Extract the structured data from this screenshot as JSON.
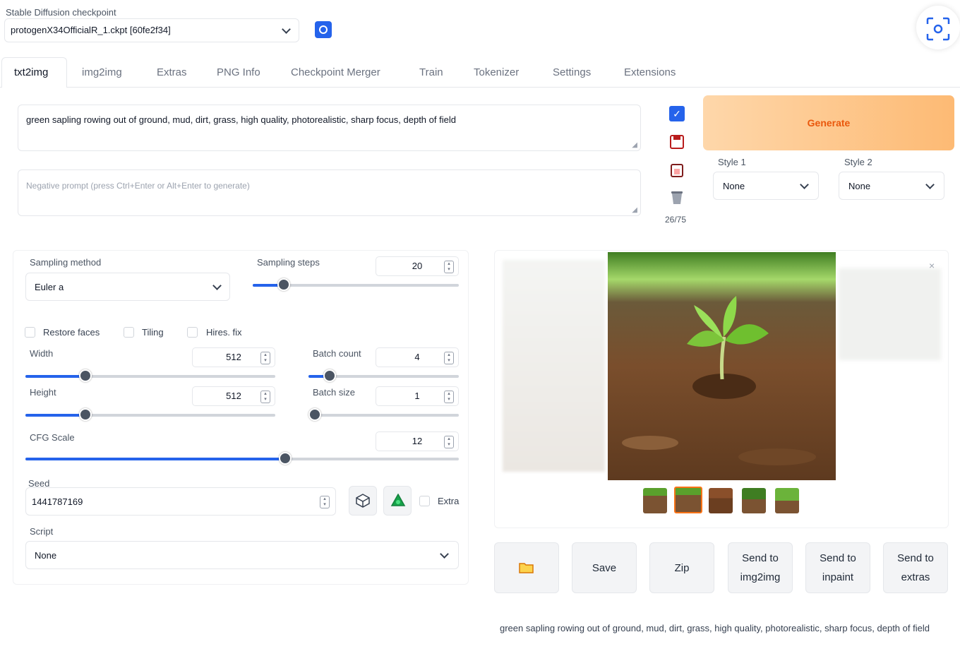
{
  "checkpoint": {
    "label": "Stable Diffusion checkpoint",
    "value": "protogenX34OfficialR_1.ckpt [60fe2f34]"
  },
  "tabs": [
    "txt2img",
    "img2img",
    "Extras",
    "PNG Info",
    "Checkpoint Merger",
    "Train",
    "Tokenizer",
    "Settings",
    "Extensions"
  ],
  "active_tab": "txt2img",
  "prompt": {
    "value": "green sapling rowing out of ground, mud, dirt, grass, high quality, photorealistic, sharp focus, depth of field"
  },
  "negative_prompt": {
    "placeholder": "Negative prompt (press Ctrl+Enter or Alt+Enter to generate)"
  },
  "token_count": "26/75",
  "generate_label": "Generate",
  "style1": {
    "label": "Style 1",
    "value": "None"
  },
  "style2": {
    "label": "Style 2",
    "value": "None"
  },
  "sampling_method": {
    "label": "Sampling method",
    "value": "Euler a"
  },
  "sampling_steps": {
    "label": "Sampling steps",
    "value": "20",
    "fraction": 0.15
  },
  "checkboxes": {
    "restore_faces": "Restore faces",
    "tiling": "Tiling",
    "hires_fix": "Hires. fix",
    "extra": "Extra"
  },
  "width": {
    "label": "Width",
    "value": "512",
    "fraction": 0.24
  },
  "height": {
    "label": "Height",
    "value": "512",
    "fraction": 0.24
  },
  "batch_count": {
    "label": "Batch count",
    "value": "4",
    "fraction": 0.14
  },
  "batch_size": {
    "label": "Batch size",
    "value": "1",
    "fraction": 0.0
  },
  "cfg_scale": {
    "label": "CFG Scale",
    "value": "12",
    "fraction": 0.6
  },
  "seed": {
    "label": "Seed",
    "value": "1441787169"
  },
  "script": {
    "label": "Script",
    "value": "None"
  },
  "buttons": {
    "save": "Save",
    "zip": "Zip",
    "send_img2img": "Send to\nimg2img",
    "send_inpaint": "Send to\ninpaint",
    "send_extras": "Send to\nextras"
  },
  "output_caption": "green sapling rowing out of ground, mud, dirt, grass, high quality, photorealistic, sharp focus, depth of field",
  "colors": {
    "accent": "#2563eb",
    "generate_bg": "#fdba74",
    "generate_text": "#ea580c"
  }
}
